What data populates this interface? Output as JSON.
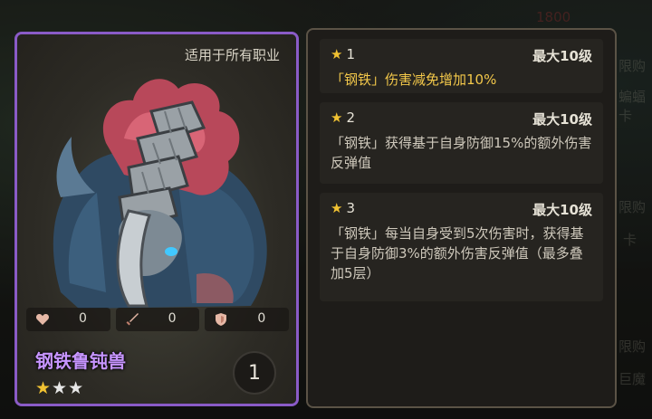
{
  "background": {
    "texts": [
      "1800",
      "限购",
      "蝙蝠卡",
      "限购",
      "卡",
      "限购",
      "巨魔"
    ]
  },
  "card": {
    "applicable": "适用于所有职业",
    "name": "钢铁鲁钝兽",
    "stars": {
      "filled": 1,
      "total": 3
    },
    "level": "1",
    "stats": [
      {
        "icon": "heart-icon",
        "value": "0"
      },
      {
        "icon": "sword-icon",
        "value": "0"
      },
      {
        "icon": "shield-icon",
        "value": "0"
      }
    ]
  },
  "skills": [
    {
      "star": "★",
      "level": "1",
      "max": "最大10级",
      "text": "「钢铁」伤害减免增加10%",
      "highlight": true
    },
    {
      "star": "★",
      "level": "2",
      "max": "最大10级",
      "text": "「钢铁」获得基于自身防御15%的额外伤害反弹值",
      "highlight": false
    },
    {
      "star": "★",
      "level": "3",
      "max": "最大10级",
      "text": "「钢铁」每当自身受到5次伤害时，获得基于自身防御3%的额外伤害反弹值（最多叠加5层）",
      "highlight": false
    }
  ],
  "colors": {
    "rarity": "#8a5bc7",
    "star": "#f1c232",
    "highlight": "#f3c84a"
  }
}
